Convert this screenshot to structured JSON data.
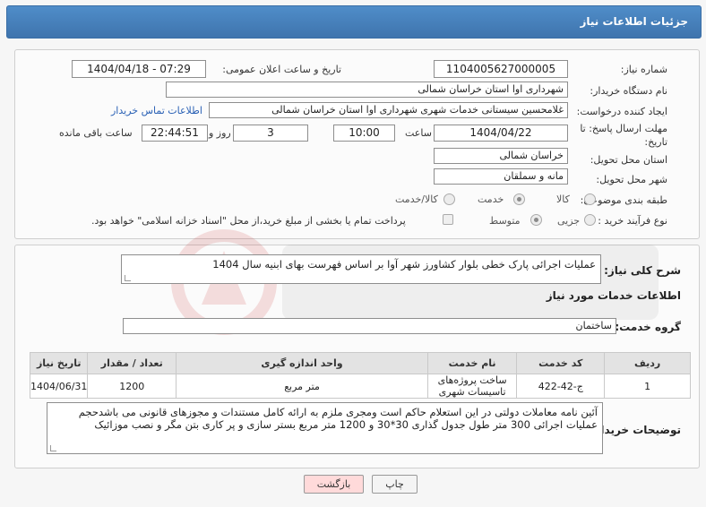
{
  "header": {
    "title": "جزئیات اطلاعات نیاز"
  },
  "form": {
    "need_number": {
      "label": "شماره نیاز:",
      "value": "1104005627000005"
    },
    "announce_datetime": {
      "label": "تاریخ و ساعت اعلان عمومی:",
      "value": "1404/04/18 - 07:29"
    },
    "buyer_org": {
      "label": "نام دستگاه خریدار:",
      "value": "شهرداری اوا استان خراسان شمالی"
    },
    "requester": {
      "label": "ایجاد کننده درخواست:",
      "value": "غلامحسین  سیستانی  خدمات شهری شهرداری اوا استان خراسان شمالی",
      "contact_link": "اطلاعات تماس خریدار"
    },
    "deadline": {
      "label_line1": "مهلت ارسال پاسخ: تا",
      "label_line2": "تاریخ:",
      "date": "1404/04/22",
      "time_label": "ساعت",
      "time": "10:00",
      "days": "3",
      "days_label": "روز و",
      "remaining": "22:44:51",
      "remaining_label": "ساعت باقی مانده"
    },
    "province": {
      "label": "استان محل تحویل:",
      "value": "خراسان شمالی"
    },
    "city": {
      "label": "شهر محل تحویل:",
      "value": "مانه و سملقان"
    },
    "category": {
      "label": "طبقه بندی موضوعی:",
      "options": [
        "کالا",
        "خدمت",
        "کالا/خدمت"
      ],
      "selected": "خدمت"
    },
    "purchase_type": {
      "label": "نوع فرآیند خرید :",
      "options": [
        "جزیی",
        "متوسط"
      ],
      "selected": "متوسط",
      "treasury_note": "پرداخت تمام یا بخشی از مبلغ خرید،از محل \"اسناد خزانه اسلامی\" خواهد بود."
    }
  },
  "details": {
    "summary_label": "شرح کلی نیاز:",
    "summary_value": "عملیات اجرائی پارک خطی بلوار کشاورز شهر آوا بر اساس فهرست بهای ابنیه سال 1404",
    "services_title": "اطلاعات خدمات مورد نیاز",
    "service_group_label": "گروه خدمت:",
    "service_group_value": "ساختمان",
    "table": {
      "headers": [
        "ردیف",
        "کد خدمت",
        "نام خدمت",
        "واحد اندازه گیری",
        "تعداد / مقدار",
        "تاریخ نیاز"
      ],
      "rows": [
        [
          "1",
          "ج-42-422",
          "ساخت پروژه‌های تاسیسات شهری",
          "متر مربع",
          "1200",
          "1404/06/31"
        ]
      ]
    },
    "buyer_notes_label": "توضیحات خریدار:",
    "buyer_notes_value": "آئین نامه معاملات دولتی در این استعلام حاکم است ومجری ملزم به ارائه کامل مستندات و مجوزهای قانونی می باشدحجم عملیات اجرائی 300 متر طول جدول گذاری 30*30 و 1200 متر مربع بستر سازی و پر کاری بتن مگر و نصب موزائیک"
  },
  "buttons": {
    "print": "چاپ",
    "back": "بازگشت"
  },
  "colors": {
    "header_bg": "#4a86c3",
    "link": "#2a61b5",
    "back_button_bg": "#ffdada"
  }
}
